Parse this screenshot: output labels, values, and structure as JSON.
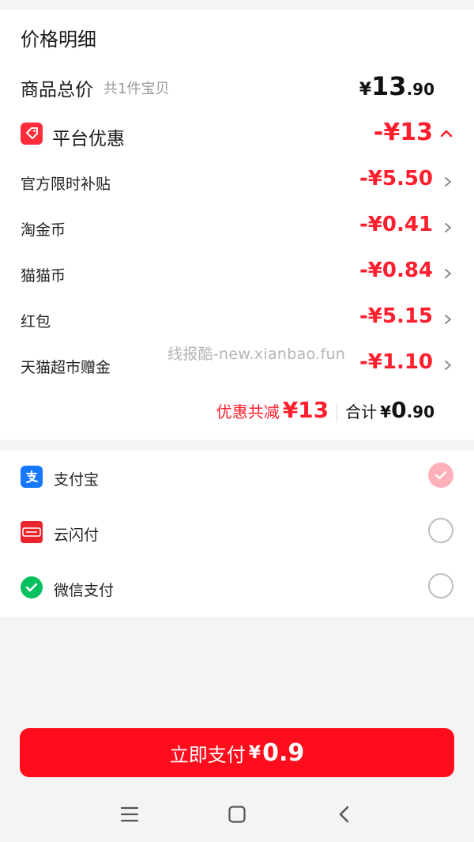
{
  "price_detail": {
    "title": "价格明细",
    "goods_total": {
      "label": "商品总价",
      "sub": "共1件宝贝",
      "yen": "¥",
      "int": "13",
      "dec": ".90"
    },
    "platform_discount": {
      "label": "平台优惠",
      "amount": "-¥13"
    },
    "discounts": [
      {
        "label": "官方限时补贴",
        "amount": "-¥5.50"
      },
      {
        "label": "淘金币",
        "amount": "-¥0.41"
      },
      {
        "label": "猫猫币",
        "amount": "-¥0.84"
      },
      {
        "label": "红包",
        "amount": "-¥5.15"
      },
      {
        "label": "天猫超市赠金",
        "amount": "-¥1.10"
      }
    ],
    "summary": {
      "discount_label": "优惠共减",
      "discount_amount": "¥13",
      "total_label": "合计",
      "total_yen": "¥",
      "total_int": "0",
      "total_dec": ".90"
    },
    "watermark": "线报酷-new.xianbao.fun"
  },
  "payment_methods": [
    {
      "label": "支付宝",
      "icon": "alipay-icon",
      "selected": true
    },
    {
      "label": "云闪付",
      "icon": "unionpay-icon",
      "selected": false
    },
    {
      "label": "微信支付",
      "icon": "wechat-pay-icon",
      "selected": false
    }
  ],
  "pay_button": {
    "label": "立即支付",
    "yen": "¥",
    "amount": "0.9"
  },
  "colors": {
    "accent_red": "#ff1e2d",
    "button_red": "#ff0d1d",
    "alipay_blue": "#1677ff",
    "wechat_green": "#07c160"
  }
}
